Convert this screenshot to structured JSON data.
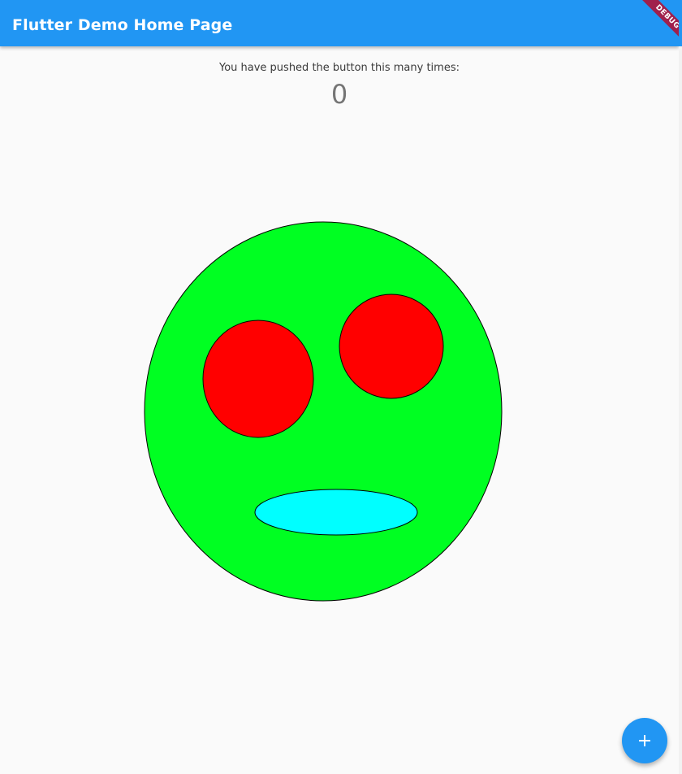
{
  "app_bar": {
    "title": "Flutter Demo Home Page",
    "color": "#2196f3",
    "debug_banner": "DEBUG",
    "debug_color": "#a0204c"
  },
  "counter": {
    "label": "You have pushed the button this many times:",
    "value": "0"
  },
  "face": {
    "head_color": "#00ff22",
    "eye_color": "#ff0000",
    "mouth_color": "#00ffff",
    "outline_color": "#000000"
  },
  "fab": {
    "icon": "plus-icon",
    "color": "#2196f3"
  }
}
